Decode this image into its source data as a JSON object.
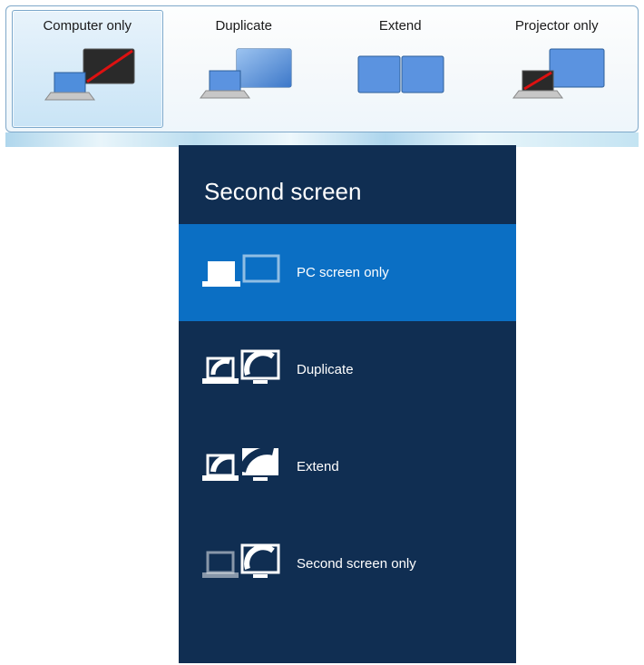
{
  "win7": {
    "options": [
      {
        "label": "Computer only",
        "selected": true
      },
      {
        "label": "Duplicate",
        "selected": false
      },
      {
        "label": "Extend",
        "selected": false
      },
      {
        "label": "Projector only",
        "selected": false
      }
    ]
  },
  "win8": {
    "title": "Second screen",
    "options": [
      {
        "label": "PC screen only",
        "selected": true
      },
      {
        "label": "Duplicate",
        "selected": false
      },
      {
        "label": "Extend",
        "selected": false
      },
      {
        "label": "Second screen only",
        "selected": false
      }
    ]
  }
}
